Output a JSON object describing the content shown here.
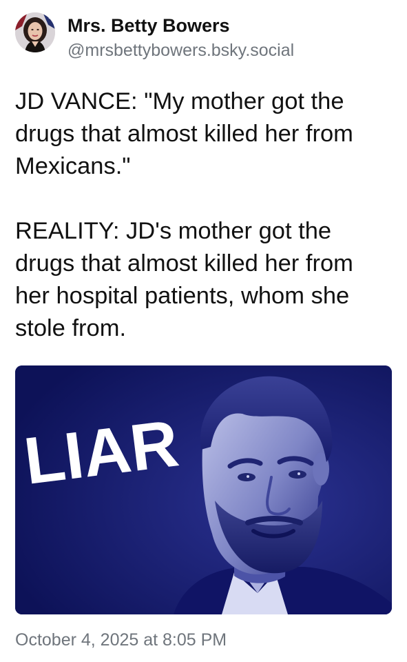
{
  "post": {
    "author": {
      "display_name": "Mrs. Betty Bowers",
      "handle": "@mrsbettybowers.bsky.social"
    },
    "text": {
      "paragraph_1": "JD VANCE: \"My mother got the drugs that almost killed her from Mexicans.\"",
      "paragraph_2": "REALITY: JD's mother got the drugs that almost killed her from her hospital patients, whom she stole from."
    },
    "image": {
      "overlay_text": "LIAR"
    },
    "timestamp": "October 4, 2025 at 8:05 PM"
  },
  "colors": {
    "image_background": "#0f1463",
    "image_tint": "#2a3190",
    "text_primary": "#111111",
    "text_secondary": "#6f757c"
  }
}
